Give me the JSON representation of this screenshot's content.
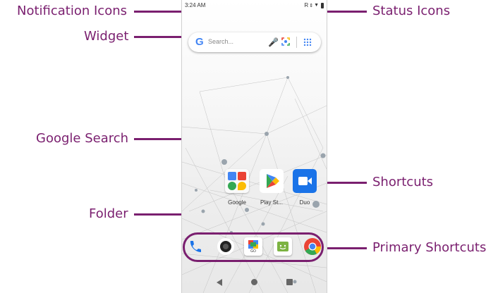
{
  "callouts": {
    "notification_icons": "Notification Icons",
    "widget": "Widget",
    "google_search": "Google Search",
    "folder": "Folder",
    "status_icons": "Status Icons",
    "shortcuts": "Shortcuts",
    "primary_shortcuts": "Primary Shortcuts"
  },
  "phone": {
    "status_time": "3:24 AM",
    "status_signal": "R",
    "search_placeholder": "Search...",
    "google_letter": "G",
    "apps": [
      {
        "label": "Google",
        "icon": "folder-icon"
      },
      {
        "label": "Play St...",
        "icon": "play-store-icon"
      },
      {
        "label": "Duo",
        "icon": "duo-icon"
      }
    ],
    "dock": [
      {
        "icon": "phone-icon"
      },
      {
        "icon": "camera-icon"
      },
      {
        "icon": "gallery-go-icon",
        "text": "GO"
      },
      {
        "icon": "messages-icon"
      },
      {
        "icon": "chrome-icon"
      }
    ]
  },
  "colors": {
    "callout": "#7a1f6f",
    "google_blue": "#4285F4",
    "google_red": "#EA4335",
    "google_yellow": "#FBBC05",
    "google_green": "#34A853",
    "duo_blue": "#1A73E8"
  }
}
